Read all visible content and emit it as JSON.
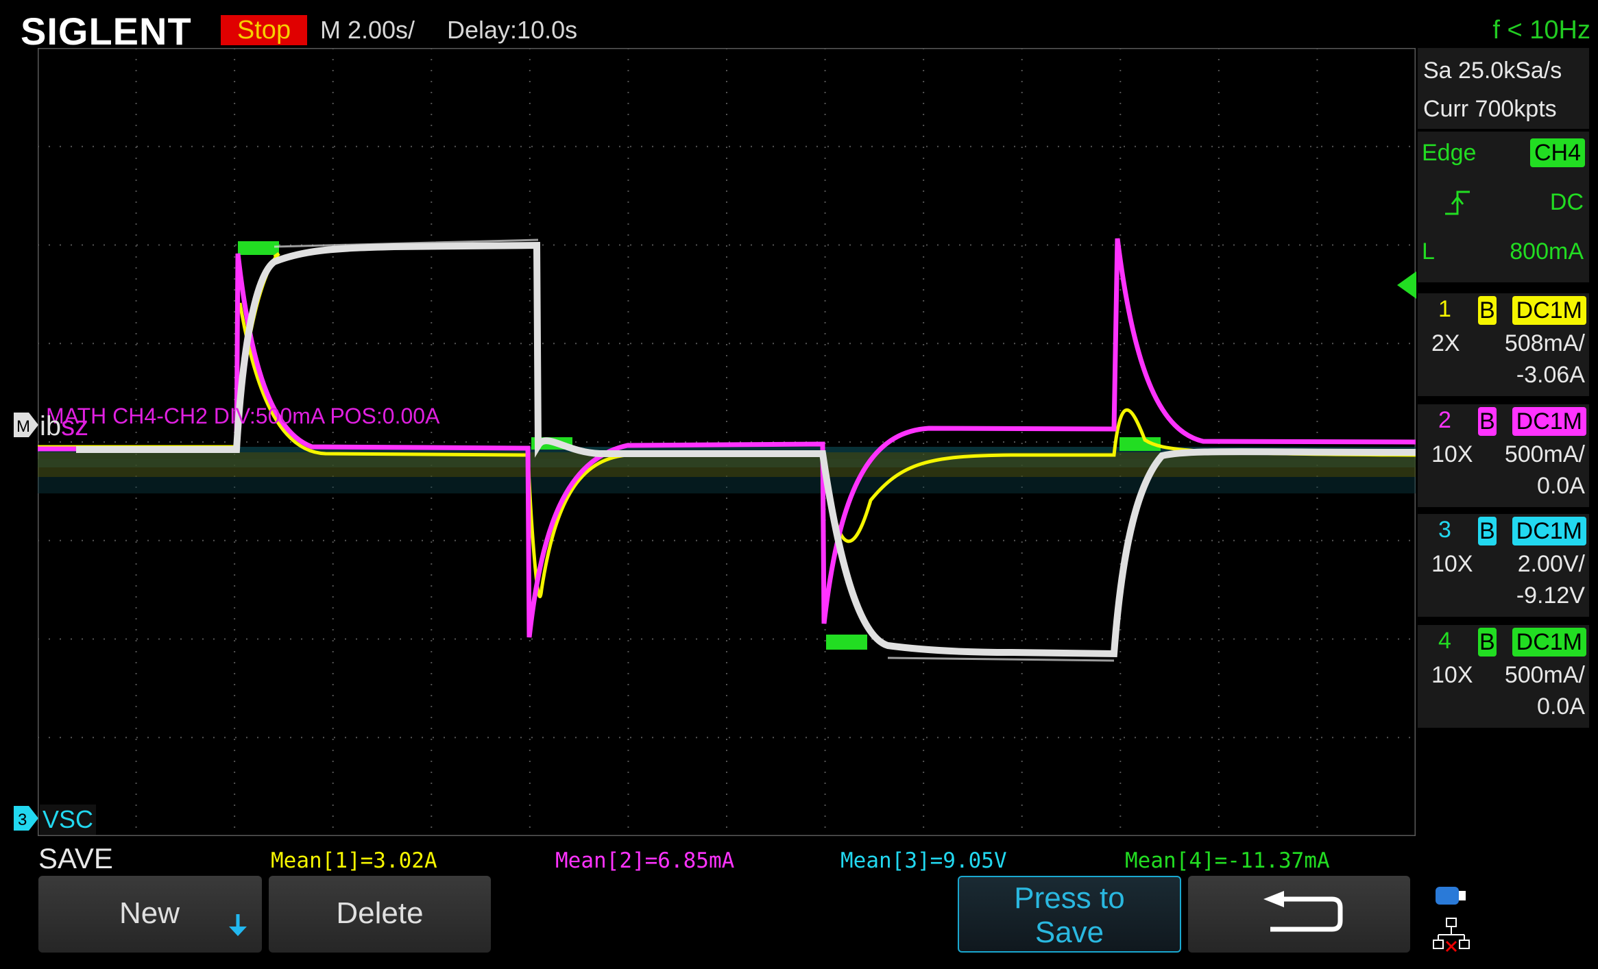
{
  "header": {
    "brand": "SIGLENT",
    "run_state": "Stop",
    "timebase": "M 2.00s/",
    "delay": "Delay:10.0s",
    "frequency": "f < 10Hz"
  },
  "acquisition": {
    "sample_rate": "Sa 25.0kSa/s",
    "memory": "Curr 700kpts"
  },
  "trigger": {
    "type": "Edge",
    "source": "CH4",
    "coupling": "DC",
    "level_label": "L",
    "level": "800mA"
  },
  "channels": [
    {
      "num": "1",
      "bw": "B",
      "coupling": "DC1M",
      "probe": "2X",
      "scale": "508mA/",
      "offset": "-3.06A",
      "color": "#f5f500"
    },
    {
      "num": "2",
      "bw": "B",
      "coupling": "DC1M",
      "probe": "10X",
      "scale": "500mA/",
      "offset": "0.0A",
      "color": "#ff33ff"
    },
    {
      "num": "3",
      "bw": "B",
      "coupling": "DC1M",
      "probe": "10X",
      "scale": "2.00V/",
      "offset": "-9.12V",
      "color": "#22d8f0"
    },
    {
      "num": "4",
      "bw": "B",
      "coupling": "DC1M",
      "probe": "10X",
      "scale": "500mA/",
      "offset": "0.0A",
      "color": "#22dd22"
    }
  ],
  "waveform_labels": {
    "math_info": "MATH  CH4-CH2   DIV:500mA  POS:0.00A",
    "math_marker": "M",
    "math_label_a": "ib",
    "math_label_b": "sz",
    "ch3_marker": "3",
    "ch3_label": "VSC"
  },
  "measurements": [
    {
      "text": "Mean[1]=3.02A",
      "color": "#f5f500"
    },
    {
      "text": "Mean[2]=6.85mA",
      "color": "#ff33ff"
    },
    {
      "text": "Mean[3]=9.05V",
      "color": "#22d8f0"
    },
    {
      "text": "Mean[4]=-11.37mA",
      "color": "#22dd22"
    }
  ],
  "menu": {
    "title": "SAVE",
    "new_label": "New",
    "delete_label": "Delete",
    "press_to_save_line1": "Press to",
    "press_to_save_line2": "Save"
  }
}
